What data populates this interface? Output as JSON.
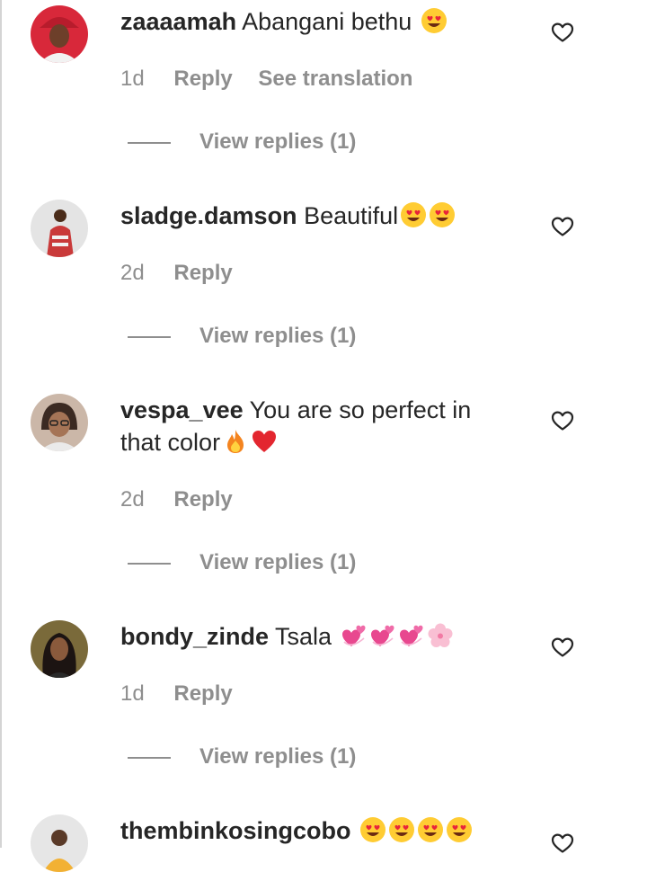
{
  "comments": [
    {
      "username": "zaaaamah",
      "text": "Abangani bethu",
      "emojis": [
        "heart-eyes-emoji"
      ],
      "time": "1d",
      "reply_label": "Reply",
      "translate_label": "See translation",
      "view_replies": "View replies (1)",
      "avatar_bg": "#d8283a"
    },
    {
      "username": "sladge.damson",
      "text": "Beautiful",
      "emojis": [
        "heart-eyes-emoji",
        "heart-eyes-emoji"
      ],
      "time": "2d",
      "reply_label": "Reply",
      "view_replies": "View replies (1)",
      "avatar_bg": "#dcdcdc"
    },
    {
      "username": "vespa_vee",
      "text": "You are so perfect in that color",
      "emojis": [
        "fire-emoji",
        "red-heart-emoji"
      ],
      "time": "2d",
      "reply_label": "Reply",
      "view_replies": "View replies (1)",
      "avatar_bg": "#b59a8c"
    },
    {
      "username": "bondy_zinde",
      "text": "Tsala",
      "emojis": [
        "revolving-hearts-emoji",
        "revolving-hearts-emoji",
        "revolving-hearts-emoji",
        "cherry-blossom-emoji"
      ],
      "time": "1d",
      "reply_label": "Reply",
      "view_replies": "View replies (1)",
      "avatar_bg": "#5a4b2a"
    },
    {
      "username": "thembinkosingcobo",
      "text": "",
      "emojis": [
        "heart-eyes-emoji",
        "heart-eyes-emoji",
        "heart-eyes-emoji",
        "heart-eyes-emoji"
      ],
      "avatar_bg": "#e6e6e6"
    }
  ],
  "icons": {
    "like": "heart-outline-icon"
  },
  "colors": {
    "text": "#262626",
    "secondary": "#8e8e8e",
    "divider": "#d4d4d4"
  }
}
